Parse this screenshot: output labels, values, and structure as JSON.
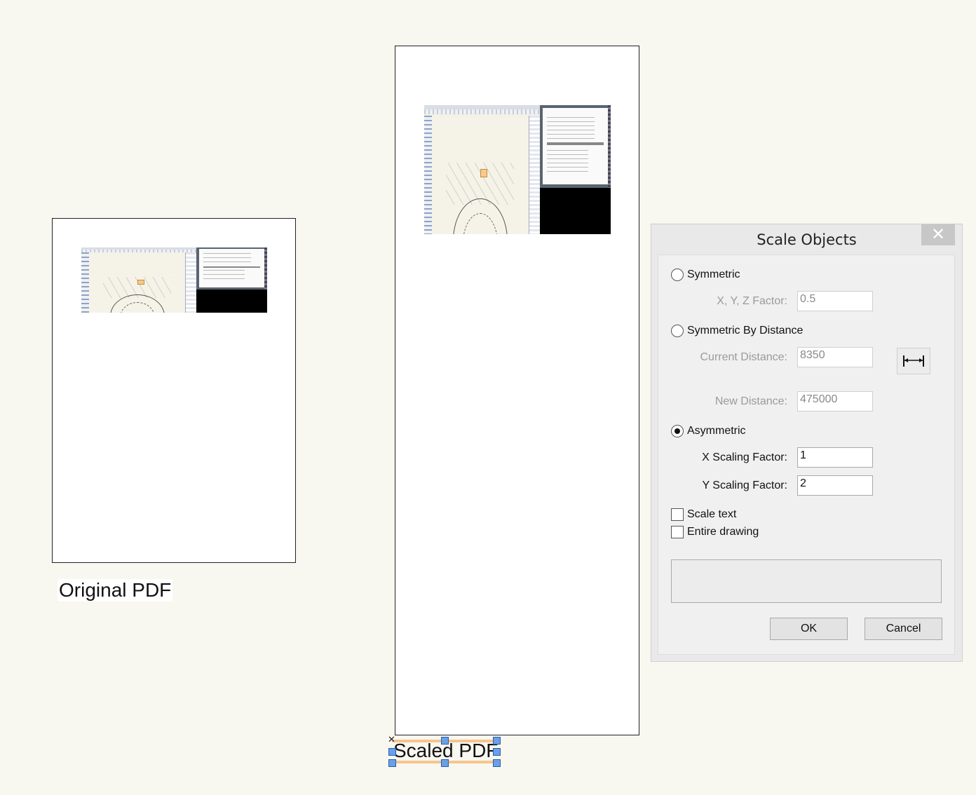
{
  "canvas": {
    "original_caption": "Original PDF",
    "scaled_caption": "Scaled PDF"
  },
  "dialog": {
    "title": "Scale Objects",
    "close_icon": "close-icon",
    "symmetric": {
      "label": "Symmetric",
      "selected": false
    },
    "xyz_factor": {
      "label": "X, Y, Z Factor:",
      "value": "0.5"
    },
    "symmetric_by_distance": {
      "label": "Symmetric By Distance",
      "selected": false
    },
    "current_distance": {
      "label": "Current Distance:",
      "value": "8350"
    },
    "new_distance": {
      "label": "New Distance:",
      "value": "475000"
    },
    "measure_icon": "dimension-measure-icon",
    "asymmetric": {
      "label": "Asymmetric",
      "selected": true
    },
    "x_scaling": {
      "label": "X Scaling Factor:",
      "value": "1"
    },
    "y_scaling": {
      "label": "Y Scaling Factor:",
      "value": "2"
    },
    "scale_text": {
      "label": "Scale text",
      "checked": false
    },
    "entire_drawing": {
      "label": "Entire drawing",
      "checked": false
    },
    "ok_label": "OK",
    "cancel_label": "Cancel"
  },
  "colors": {
    "background": "#f8f7f0",
    "selection_highlight": "#f6c58e",
    "handle": "#6aa0e8"
  }
}
